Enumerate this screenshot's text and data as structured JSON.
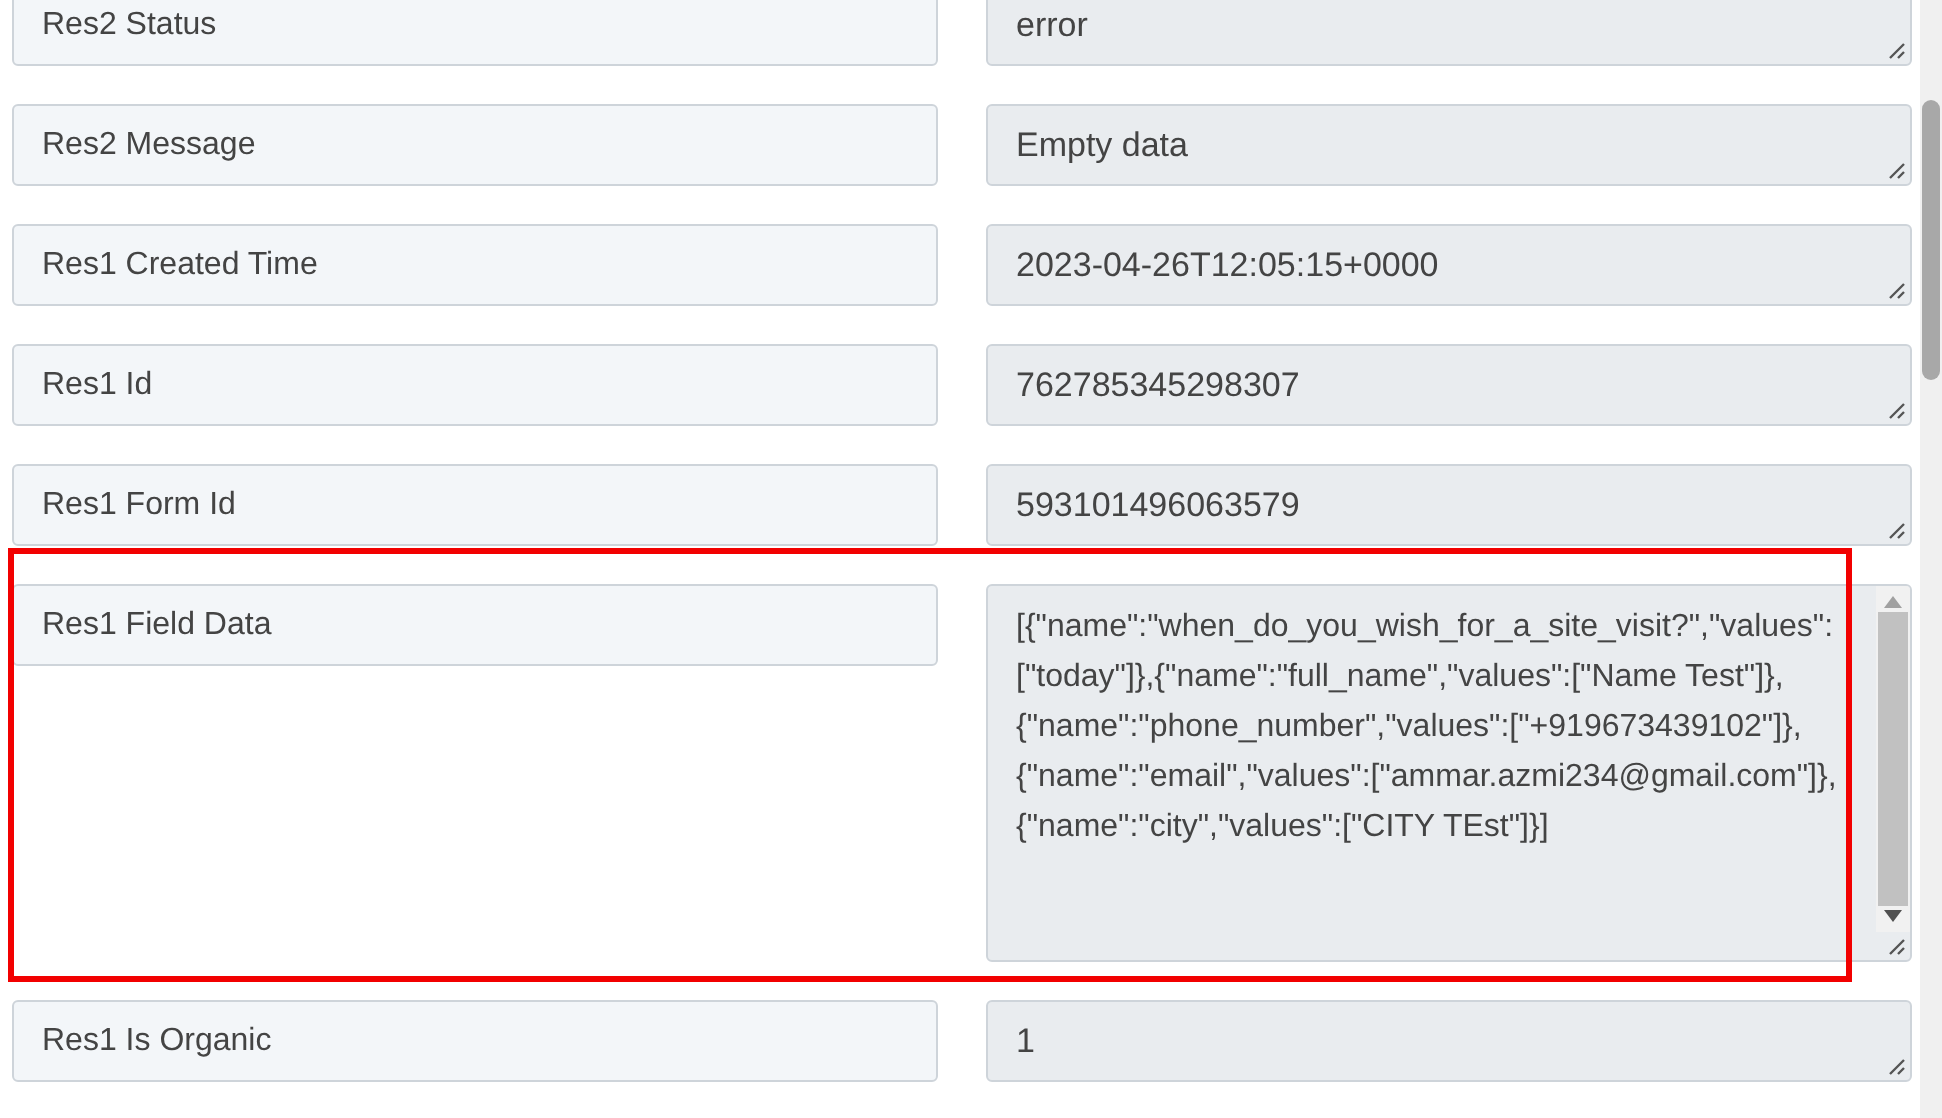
{
  "rows": [
    {
      "label": "Res2 Status",
      "value": "error",
      "highlighted": false
    },
    {
      "label": "Res2 Message",
      "value": "Empty data",
      "highlighted": false
    },
    {
      "label": "Res1 Created Time",
      "value": "2023-04-26T12:05:15+0000",
      "highlighted": false
    },
    {
      "label": "Res1 Id",
      "value": "762785345298307",
      "highlighted": false
    },
    {
      "label": "Res1 Form Id",
      "value": "593101496063579",
      "highlighted": false
    },
    {
      "label": "Res1 Field Data",
      "value": "[{\"name\":\"when_do_you_wish_for_a_site_visit?\",\"values\":[\"today\"]},{\"name\":\"full_name\",\"values\":[\"Name Test\"]},{\"name\":\"phone_number\",\"values\":[\"+919673439102\"]},{\"name\":\"email\",\"values\":[\"ammar.azmi234@gmail.com\"]},{\"name\":\"city\",\"values\":[\"CITY TEst\"]}]",
      "highlighted": true,
      "multiline": true
    },
    {
      "label": "Res1 Is Organic",
      "value": "1",
      "highlighted": false
    }
  ]
}
